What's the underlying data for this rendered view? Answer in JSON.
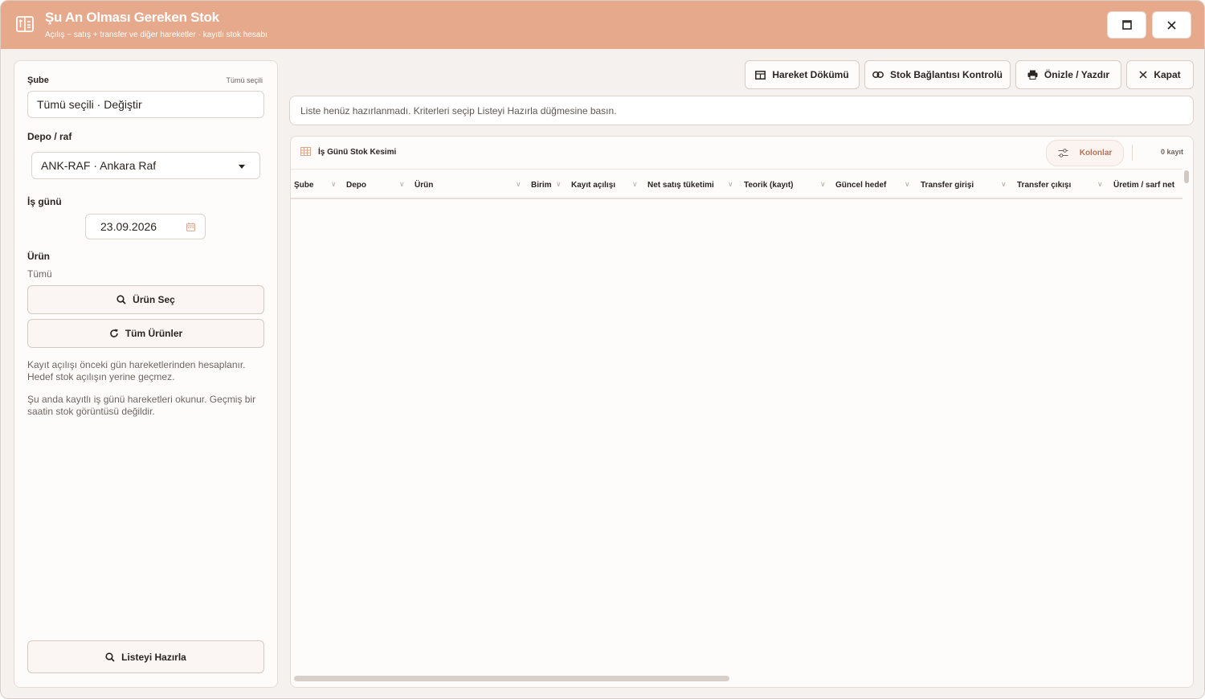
{
  "window": {
    "title": "Şu An Olması Gereken Stok",
    "subtitle": "Açılış − satış + transfer ve diğer hareketler · kayıtlı stok hesabı"
  },
  "filters": {
    "branch_label": "Şube",
    "branch_hint": "Tümü seçili",
    "branch_value": "Tümü seçili · Değiştir",
    "depot_label": "Depo / raf",
    "depot_value": "ANK-RAF · Ankara Raf",
    "workday_label": "İş günü",
    "workday_value": "23.09.2026",
    "product_label": "Ürün",
    "product_value": "Tümü",
    "select_product_button": "Ürün Seç",
    "all_products_button": "Tüm Ürünler",
    "note1": "Kayıt açılışı önceki gün hareketlerinden hesaplanır. Hedef stok açılışın yerine geçmez.",
    "note2": "Şu anda kayıtlı iş günü hareketleri okunur. Geçmiş bir saatin stok görüntüsü değildir.",
    "prepare_button": "Listeyi Hazırla"
  },
  "toolbar": {
    "movement_dump": "Hareket Dökümü",
    "link_check": "Stok Bağlantısı Kontrolü",
    "preview_print": "Önizle / Yazdır",
    "close": "Kapat"
  },
  "info": {
    "message": "Liste henüz hazırlanmadı. Kriterleri seçip Listeyi Hazırla düğmesine basın."
  },
  "grid": {
    "title": "İş Günü Stok Kesimi",
    "columns_button": "Kolonlar",
    "record_count": "0 kayıt",
    "headers": [
      "Şube",
      "Depo",
      "Ürün",
      "Birim",
      "Kayıt açılışı",
      "Net satış tüketimi",
      "Teorik (kayıt)",
      "Güncel hedef",
      "Transfer girişi",
      "Transfer çıkışı",
      "Üretim / sarf net"
    ],
    "rows": []
  },
  "colors": {
    "titlebar": "#e6a98b",
    "accent": "#b5715a",
    "background": "#f4f1ef"
  }
}
